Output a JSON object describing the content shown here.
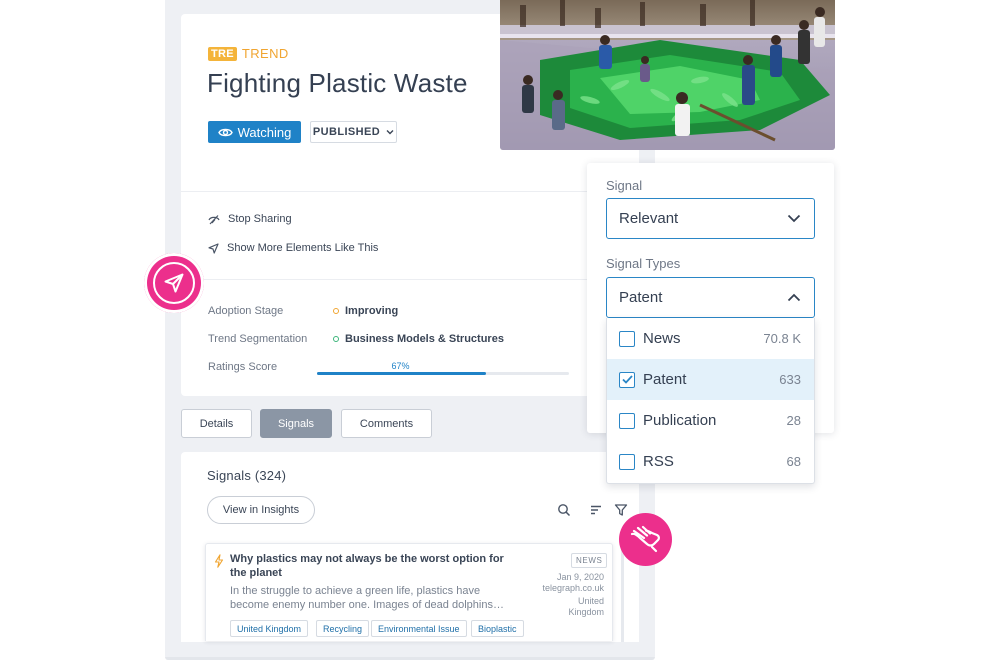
{
  "trend_tag": {
    "badge": "TRE",
    "label": "TREND"
  },
  "title": "Fighting Plastic Waste",
  "watch_button": {
    "label": "Watching"
  },
  "status_select": {
    "label": "PUBLISHED"
  },
  "actions": [
    {
      "label": "Stop Sharing",
      "icon": "eye-slash-icon"
    },
    {
      "label": "Show More Elements Like This",
      "icon": "send-icon"
    }
  ],
  "meta": {
    "adoption": {
      "label": "Adoption Stage",
      "value": "Improving",
      "color": "#f0a531"
    },
    "segmentation": {
      "label": "Trend Segmentation",
      "value": "Business Models & Structures",
      "color": "#3bb57a"
    },
    "rating": {
      "label": "Ratings Score",
      "value_text": "67%",
      "value": 0.67
    }
  },
  "tabs": [
    {
      "label": "Details"
    },
    {
      "label": "Signals"
    },
    {
      "label": "Comments"
    }
  ],
  "signals": {
    "title": "Signals (324)",
    "insights_button": "View in Insights",
    "item": {
      "title": "Why plastics may not always be the worst option for the planet",
      "description": "In the struggle to achieve a green life, plastics have become enemy number one. Images of dead dolphins…",
      "type": "NEWS",
      "date": "Jan 9, 2020",
      "source": "telegraph.co.uk",
      "country_line1": "United",
      "country_line2": "Kingdom",
      "tags": [
        "United Kingdom",
        "Recycling",
        "Environmental Issue",
        "Bioplastic"
      ]
    }
  },
  "filter": {
    "signal": {
      "label": "Signal",
      "value": "Relevant"
    },
    "signal_types": {
      "label": "Signal Types",
      "value": "Patent",
      "options": [
        {
          "label": "News",
          "count": "70.8 K",
          "checked": false
        },
        {
          "label": "Patent",
          "count": "633",
          "checked": true
        },
        {
          "label": "Publication",
          "count": "28",
          "checked": false
        },
        {
          "label": "RSS",
          "count": "68",
          "checked": false
        }
      ]
    }
  },
  "colors": {
    "accent": "#1f82c7",
    "pink": "#ec2f8c",
    "trend_orange": "#f0a531"
  }
}
